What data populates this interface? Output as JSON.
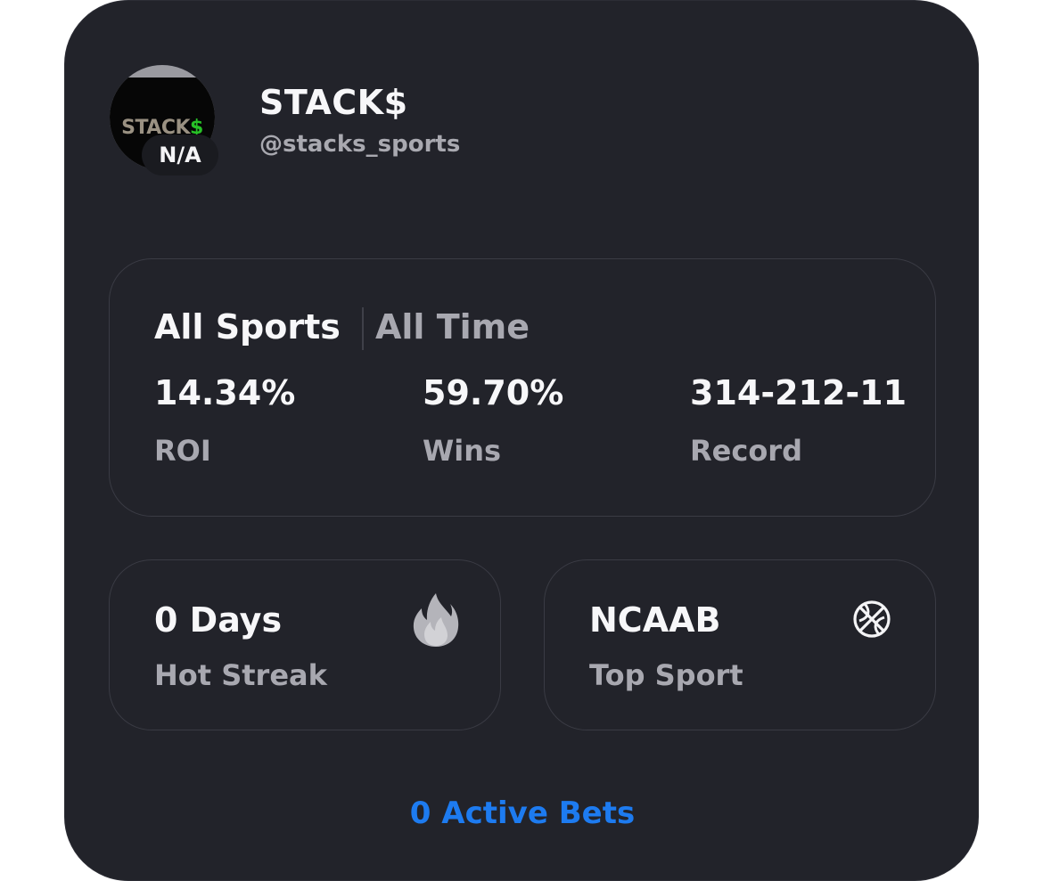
{
  "profile": {
    "avatar_logo_text": "STACK",
    "avatar_logo_dollar": "$",
    "badge": "N/A",
    "display_name": "STACK$",
    "handle": "@stacks_sports"
  },
  "stats": {
    "filter_sport": "All Sports",
    "filter_time": "All Time",
    "items": [
      {
        "value": "14.34%",
        "label": "ROI"
      },
      {
        "value": "59.70%",
        "label": "Wins"
      },
      {
        "value": "314-212-11",
        "label": "Record"
      }
    ]
  },
  "tiles": {
    "streak": {
      "value": "0 Days",
      "label": "Hot Streak",
      "icon": "fire-icon"
    },
    "top_sport": {
      "value": "NCAAB",
      "label": "Top Sport",
      "icon": "basketball-icon"
    }
  },
  "footer": {
    "active_bets": "0 Active Bets"
  },
  "colors": {
    "card_bg": "#22232a",
    "panel_border": "#3a3b44",
    "primary_text": "#f7f7f9",
    "secondary_text": "#a8a8b0",
    "accent": "#1d7bf0",
    "logo_green": "#27c127"
  }
}
